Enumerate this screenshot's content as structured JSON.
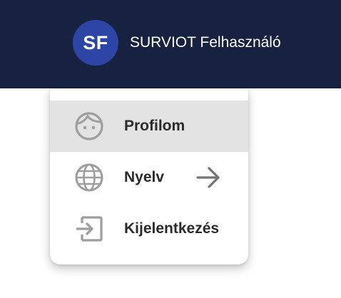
{
  "header": {
    "avatar_initials": "SF",
    "user_name": "SURVIOT Felhasználó",
    "background_color": "#172240",
    "avatar_color": "#2d46a6"
  },
  "menu": {
    "items": [
      {
        "label": "Profilom",
        "icon": "face-icon",
        "active": true
      },
      {
        "label": "Nyelv",
        "icon": "globe-icon",
        "submenu_icon": "arrow-right-icon",
        "active": false
      },
      {
        "label": "Kijelentkezés",
        "icon": "logout-icon",
        "active": false
      }
    ],
    "active_background": "#e3e3e3"
  }
}
